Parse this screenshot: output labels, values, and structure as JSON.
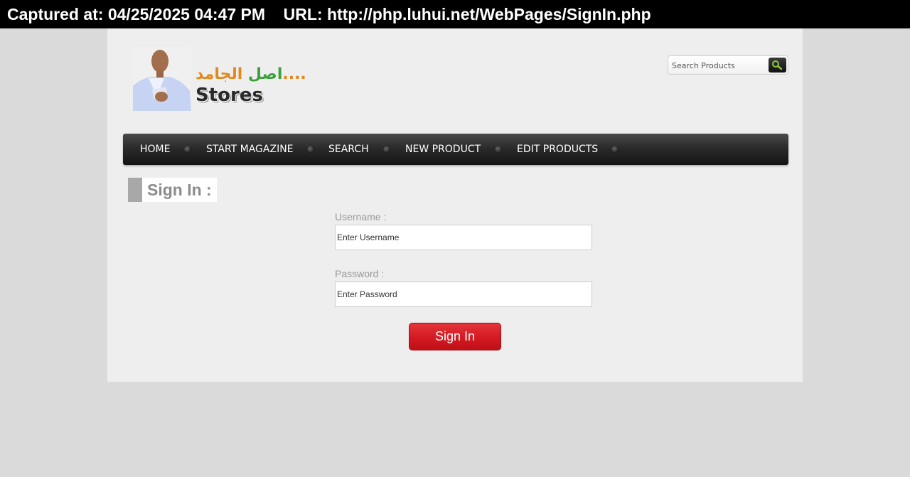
{
  "capture": {
    "text": "Captured at: 04/25/2025 04:47 PM    URL: http://php.luhui.net/WebPages/SignIn.php"
  },
  "logo": {
    "arabic_text_part1": "اصل",
    "arabic_text_part2": "الجامد....",
    "stores_text": "Stores"
  },
  "search": {
    "placeholder": "Search Products",
    "button_icon": "search-icon"
  },
  "nav": {
    "items": [
      {
        "label": "HOME"
      },
      {
        "label": "START MAGAZINE"
      },
      {
        "label": "SEARCH"
      },
      {
        "label": "NEW PRODUCT"
      },
      {
        "label": "EDIT PRODUCTS"
      }
    ]
  },
  "main": {
    "heading": "Sign In :",
    "username_label": "Username :",
    "username_placeholder": "Enter Username",
    "password_label": "Password :",
    "password_placeholder": "Enter Password",
    "submit_label": "Sign In"
  },
  "colors": {
    "page_background": "#dadada",
    "content_background": "#eeeeee",
    "navbar": "#2b2b2b",
    "signin_button": "#d41a22",
    "heading_text": "#8c8c8c"
  }
}
